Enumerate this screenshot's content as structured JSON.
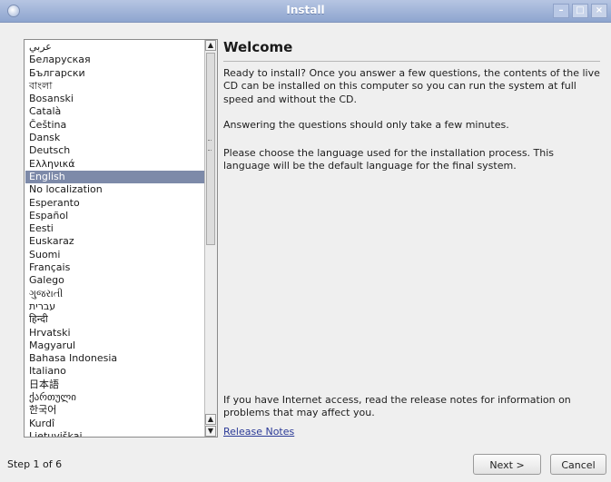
{
  "window": {
    "title": "Install",
    "controls": [
      "minimize",
      "maximize",
      "close"
    ]
  },
  "language_list": {
    "items": [
      "عربي",
      "Беларуская",
      "Български",
      "বাংলা",
      "Bosanski",
      "Català",
      "Čeština",
      "Dansk",
      "Deutsch",
      "Ελληνικά",
      "English",
      "No localization",
      "Esperanto",
      "Español",
      "Eesti",
      "Euskaraz",
      "Suomi",
      "Français",
      "Galego",
      "ગુજરાતી",
      "עברית",
      "हिन्दी",
      "Hrvatski",
      "Magyarul",
      "Bahasa Indonesia",
      "Italiano",
      "日本語",
      "ქართული",
      "한국어",
      "Kurdî",
      "Lietuviškai"
    ],
    "selected": "English"
  },
  "content": {
    "heading": "Welcome",
    "intro": "Ready to install? Once you answer a few questions, the contents of the live CD can be installed on this computer so you can run the system at full speed and without the CD.",
    "time_note": "Answering the questions should only take a few minutes.",
    "language_prompt": "Please choose the language used for the installation process. This language will be the default language for the final system.",
    "release_note_text": "If you have Internet access, read the release notes for information on problems that may affect you.",
    "release_notes_link": "Release Notes"
  },
  "footer": {
    "step_text": "Step 1 of 6",
    "next_label": "Next >",
    "cancel_label": "Cancel"
  },
  "colors": {
    "selection": "#7d8aa9",
    "titlebar": "#9fb2d9",
    "link": "#2b3a97"
  }
}
